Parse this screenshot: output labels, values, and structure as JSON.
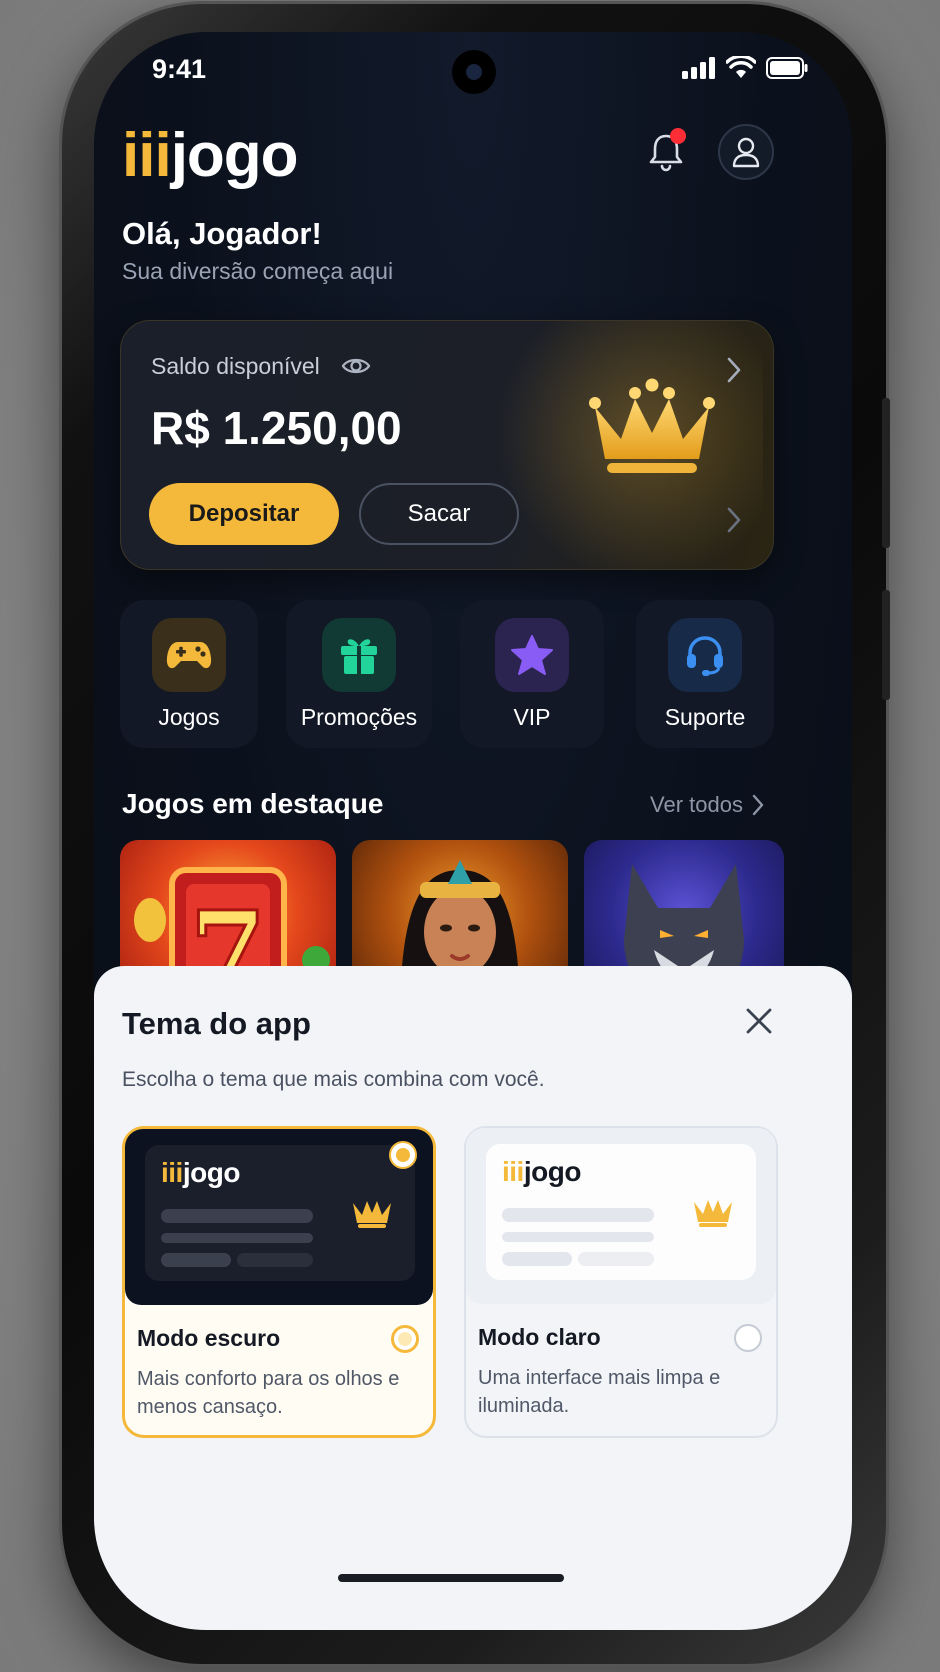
{
  "status_bar": {
    "time": "9:41"
  },
  "header": {
    "logo_iii": "iii",
    "logo_jogo": "jogo",
    "greeting": "Olá, Jogador!",
    "subtitle": "Sua diversão começa aqui"
  },
  "balance": {
    "label": "Saldo disponível",
    "amount": "R$ 1.250,00",
    "deposit_label": "Depositar",
    "withdraw_label": "Sacar"
  },
  "quick_actions": [
    {
      "label": "Jogos",
      "icon": "gamepad-icon",
      "color": "#f4b93a"
    },
    {
      "label": "Promoções",
      "icon": "gift-icon",
      "color": "#22d39a"
    },
    {
      "label": "VIP",
      "icon": "star-icon",
      "color": "#8a5cf6"
    },
    {
      "label": "Suporte",
      "icon": "headset-icon",
      "color": "#3b8ff0"
    }
  ],
  "featured": {
    "title": "Jogos em destaque",
    "see_all": "Ver todos",
    "games": [
      {
        "icon": "slot-seven-icon"
      },
      {
        "icon": "cleopatra-icon"
      },
      {
        "icon": "wolf-icon"
      }
    ]
  },
  "theme_sheet": {
    "title": "Tema do app",
    "description": "Escolha o tema que mais combina com você.",
    "options": [
      {
        "preview_iii": "iii",
        "preview_jogo": "jogo",
        "name": "Modo escuro",
        "desc": "Mais conforto para os olhos e menos cansaço.",
        "selected": true
      },
      {
        "preview_iii": "iii",
        "preview_jogo": "jogo",
        "name": "Modo claro",
        "desc": "Uma interface mais limpa e iluminada.",
        "selected": false
      }
    ]
  },
  "colors": {
    "accent": "#f4b93a",
    "notification": "#ff2d36",
    "background": "#0b111c"
  }
}
